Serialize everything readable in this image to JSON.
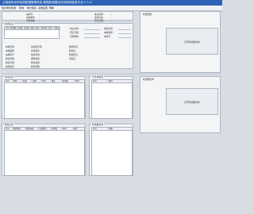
{
  "window": {
    "title": "云南省机动车检测数据管理系统-数据系统整合在线检测信息平台 V 1.0"
  },
  "menu": [
    "信息登记",
    "检测",
    "查询",
    "统计报表",
    "系统设置",
    "帮助"
  ],
  "header": {
    "counter": "0",
    "left_labels": [
      "车牌号:",
      "车辆类型:",
      "号牌种类:"
    ],
    "left_values": [
      "--",
      "--",
      "--"
    ],
    "right_labels": [
      "车主名称:",
      "使用性质:",
      "登记日期:"
    ],
    "right_values": [
      "--",
      "--",
      "--"
    ]
  },
  "frames": {
    "frame1": "检测信息",
    "frame2": "车主信息",
    "frame3": "检测结果",
    "frame4": "不合格项目",
    "frame5": "整改记录",
    "frame6": "检测报告单"
  },
  "grid1": {
    "headers": [
      "序号",
      "检测项",
      "标准值",
      "实测值",
      "结果",
      "备注",
      "检测员",
      "时间",
      "复检"
    ]
  },
  "grid2": {
    "headers": [
      "序号",
      "项目",
      "标准",
      "实测",
      "判定",
      "备注",
      "检测员",
      "时间"
    ]
  },
  "grid3": {
    "headers": [
      "序号",
      "项目"
    ]
  },
  "grid4": {
    "headers": [
      "序号",
      "整改项目",
      "整改内容",
      "完成情况",
      "检测员",
      "时间",
      "备注"
    ]
  },
  "grid5": {
    "headers": [
      "序号",
      "金额"
    ]
  },
  "right_buttons": [
    "打开检测报告单",
    "打开检测报告单"
  ],
  "form_rows": [
    [
      "车辆号牌:",
      "发动机号码:",
      "检测时间:"
    ],
    [
      "车辆品牌:",
      "车身颜色:",
      "检测员:"
    ],
    [
      "车辆型号:",
      "使用年限:",
      "检测结论:"
    ],
    [
      "检验机构:",
      "燃料种类:",
      "审核员:"
    ],
    [
      "检验日期:",
      "检验类别:",
      ""
    ],
    [
      "检测线号:",
      "检测次数:",
      ""
    ]
  ]
}
